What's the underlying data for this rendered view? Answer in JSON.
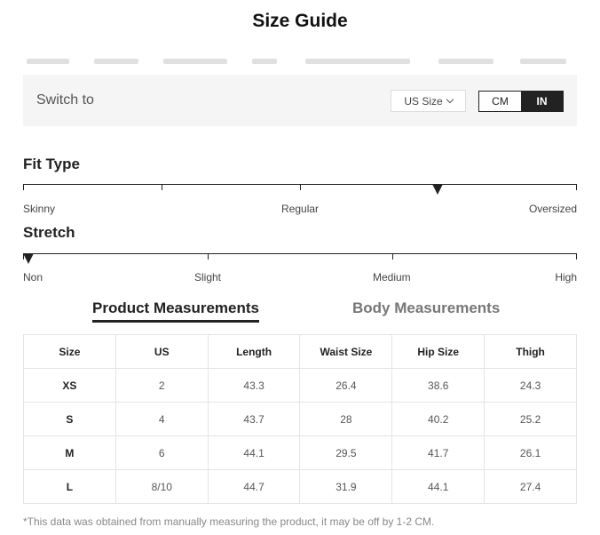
{
  "title": "Size Guide",
  "switch": {
    "label": "Switch to",
    "size_select": "US Size",
    "units": [
      "CM",
      "IN"
    ],
    "active_unit": "IN"
  },
  "fit_type": {
    "heading": "Fit Type",
    "labels": [
      "Skinny",
      "Regular",
      "Oversized"
    ],
    "marker_fraction": 0.75
  },
  "stretch": {
    "heading": "Stretch",
    "labels": [
      "Non",
      "Slight",
      "Medium",
      "High"
    ],
    "marker_fraction": 0.0
  },
  "tabs": [
    "Product Measurements",
    "Body Measurements"
  ],
  "active_tab": "Product Measurements",
  "table": {
    "headers": [
      "Size",
      "US",
      "Length",
      "Waist Size",
      "Hip Size",
      "Thigh"
    ],
    "rows": [
      [
        "XS",
        "2",
        "43.3",
        "26.4",
        "38.6",
        "24.3"
      ],
      [
        "S",
        "4",
        "43.7",
        "28",
        "40.2",
        "25.2"
      ],
      [
        "M",
        "6",
        "44.1",
        "29.5",
        "41.7",
        "26.1"
      ],
      [
        "L",
        "8/10",
        "44.7",
        "31.9",
        "44.1",
        "27.4"
      ]
    ]
  },
  "footnote": "*This data was obtained from manually measuring the product, it may be off by 1-2 CM.",
  "icons": {
    "size_select": "chevron-down-icon",
    "scale_marker": "triangle-down-icon"
  }
}
